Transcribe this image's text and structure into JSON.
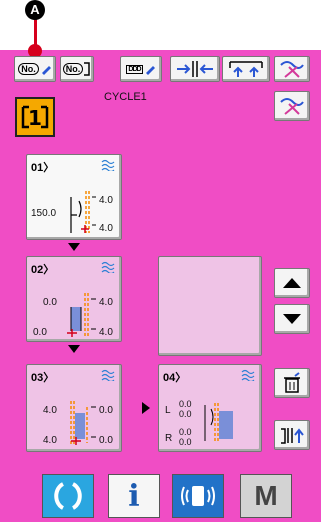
{
  "annotation": {
    "marker_label": "A"
  },
  "toolbar": {
    "items": [
      {
        "label": "No.",
        "icon": "pattern-no-edit-icon"
      },
      {
        "label": "No.",
        "icon": "cycle-no-icon"
      },
      {
        "label": "DDD",
        "icon": "text-edit-icon"
      },
      {
        "icon": "width-adjust-icon"
      },
      {
        "icon": "bobbin-winder-icon"
      },
      {
        "icon": "thread-trim-icon"
      }
    ]
  },
  "cycle": {
    "title": "CYCLE1",
    "icon": "cycle-program-icon",
    "number": "1"
  },
  "steps": [
    {
      "num": "01",
      "values": {
        "top_right": "4.0",
        "left": "150.0",
        "bottom_right": "4.0"
      }
    },
    {
      "num": "02",
      "values": {
        "top_left": "0.0",
        "top_right": "4.0",
        "bottom_left": "0.0",
        "bottom_right": "4.0"
      }
    },
    {
      "num": "03",
      "values": {
        "top_left": "4.0",
        "top_right": "0.0",
        "bottom_left": "4.0",
        "bottom_right": "0.0"
      }
    },
    {
      "num": "04",
      "values": {
        "L_top": "0.0",
        "L_bottom": "0.0",
        "R_top": "0.0",
        "R_bottom": "0.0",
        "L": "L",
        "R": "R"
      }
    }
  ],
  "side": {
    "items": [
      "thread-trim-reverse-icon",
      "scroll-up-icon",
      "scroll-down-icon",
      "delete-step-icon",
      "insert-step-icon"
    ]
  },
  "bottom": {
    "items": [
      {
        "icon": "ready-key-icon"
      },
      {
        "label": "i",
        "icon": "info-key-icon"
      },
      {
        "icon": "communication-key-icon"
      },
      {
        "label": "M",
        "icon": "mode-key-icon"
      }
    ]
  },
  "colors": {
    "background": "#f04dc5",
    "accent": "#f5a800",
    "panel": "#efc3e6"
  }
}
